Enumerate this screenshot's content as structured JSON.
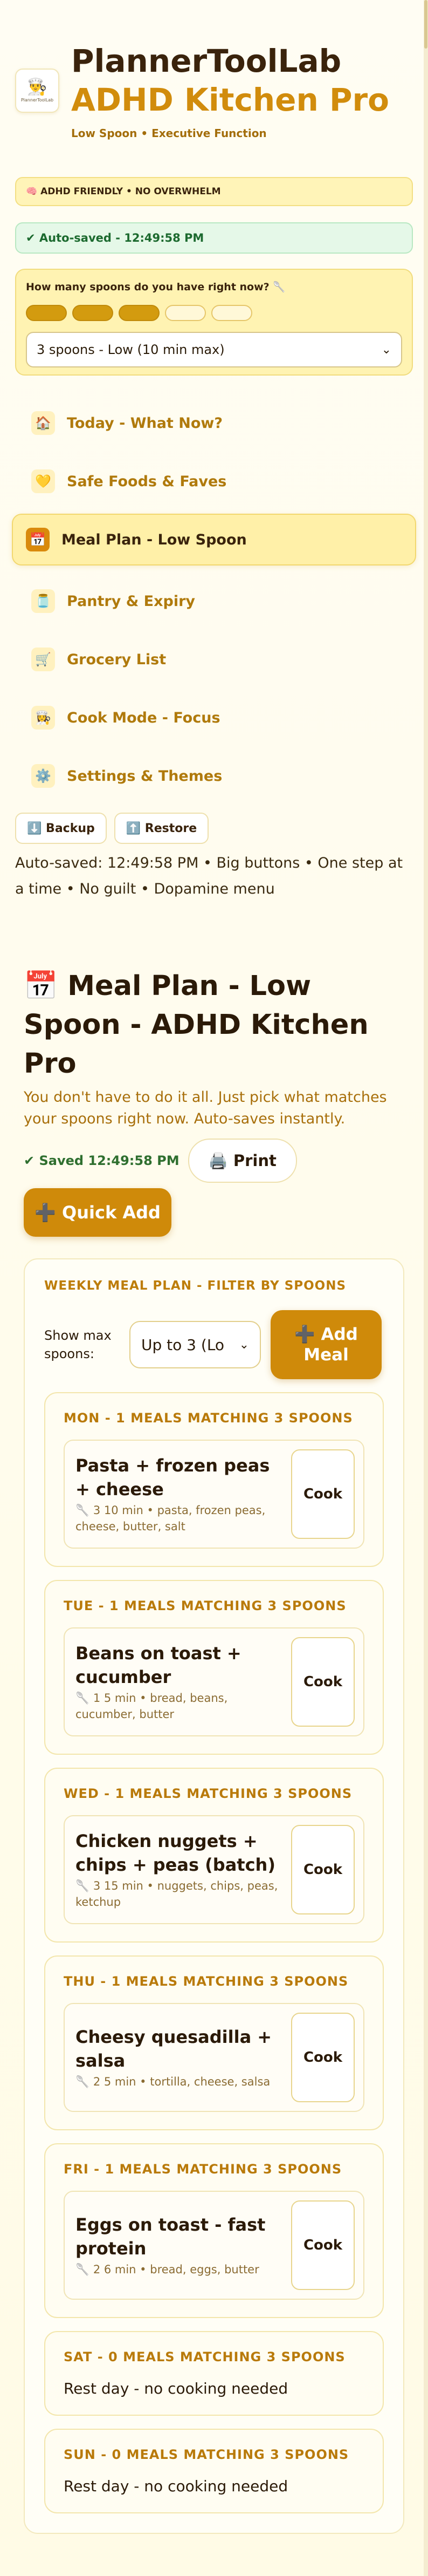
{
  "brand": {
    "logo_icon": "chef-hat-icon",
    "logo_caption": "PlannerToolLab",
    "title_line1": "PlannerToolLab",
    "title_line2": "ADHD Kitchen Pro",
    "tagline": "Low Spoon • Executive Function"
  },
  "badges": {
    "adhd": "🧠 ADHD FRIENDLY • NO OVERWHELM",
    "autosaved": "✔ Auto-saved - 12:49:58 PM"
  },
  "spoons": {
    "question": "How many spoons do you have right now? 🥄",
    "total": 5,
    "filled": 3,
    "selected": "3 spoons - Low (10 min max)"
  },
  "nav": [
    {
      "label": "Today - What Now?",
      "icon": "🏠",
      "active": false
    },
    {
      "label": "Safe Foods & Faves",
      "icon": "💛",
      "active": false
    },
    {
      "label": "Meal Plan - Low Spoon",
      "icon": "📅",
      "active": true
    },
    {
      "label": "Pantry & Expiry",
      "icon": "🫙",
      "active": false
    },
    {
      "label": "Grocery List",
      "icon": "🛒",
      "active": false
    },
    {
      "label": "Cook Mode - Focus",
      "icon": "👩‍🍳",
      "active": false
    },
    {
      "label": "Settings & Themes",
      "icon": "⚙️",
      "active": false
    }
  ],
  "utility": {
    "backup": "⬇️ Backup",
    "restore": "⬆️ Restore"
  },
  "footer_note": "Auto-saved: 12:49:58 PM • Big buttons • One step at a time • No guilt • Dopamine menu",
  "main": {
    "title": "📅 Meal Plan - Low Spoon - ADHD Kitchen Pro",
    "subtitle": "You don't have to do it all. Just pick what matches your spoons right now. Auto-saves instantly.",
    "saved_label": "✔ Saved 12:49:58 PM",
    "print_label": "🖨️ Print",
    "quick_add_label": "➕ Quick Add"
  },
  "plan": {
    "heading": "WEEKLY MEAL PLAN - FILTER BY SPOONS",
    "filter_label": "Show max spoons:",
    "filter_value": "Up to 3 (Lo",
    "add_meal_label": "➕ Add Meal",
    "cook_label": "Cook",
    "days": [
      {
        "heading": "MON - 1 MEALS MATCHING 3 SPOONS",
        "meals": [
          {
            "name": "Pasta + frozen peas + cheese",
            "meta": "🥄 3 10 min • pasta, frozen peas, cheese, butter, salt"
          }
        ]
      },
      {
        "heading": "TUE - 1 MEALS MATCHING 3 SPOONS",
        "meals": [
          {
            "name": "Beans on toast + cucumber",
            "meta": "🥄 1 5 min • bread, beans, cucumber, butter"
          }
        ]
      },
      {
        "heading": "WED - 1 MEALS MATCHING 3 SPOONS",
        "meals": [
          {
            "name": "Chicken nuggets + chips + peas (batch)",
            "meta": "🥄 3 15 min • nuggets, chips, peas, ketchup"
          }
        ]
      },
      {
        "heading": "THU - 1 MEALS MATCHING 3 SPOONS",
        "meals": [
          {
            "name": "Cheesy quesadilla + salsa",
            "meta": "🥄 2 5 min • tortilla, cheese, salsa"
          }
        ]
      },
      {
        "heading": "FRI - 1 MEALS MATCHING 3 SPOONS",
        "meals": [
          {
            "name": "Eggs on toast - fast protein",
            "meta": "🥄 2 6 min • bread, eggs, butter"
          }
        ]
      },
      {
        "heading": "SAT - 0 MEALS MATCHING 3 SPOONS",
        "meals": [],
        "rest": "Rest day - no cooking needed"
      },
      {
        "heading": "SUN - 0 MEALS MATCHING 3 SPOONS",
        "meals": [],
        "rest": "Rest day - no cooking needed"
      }
    ]
  }
}
